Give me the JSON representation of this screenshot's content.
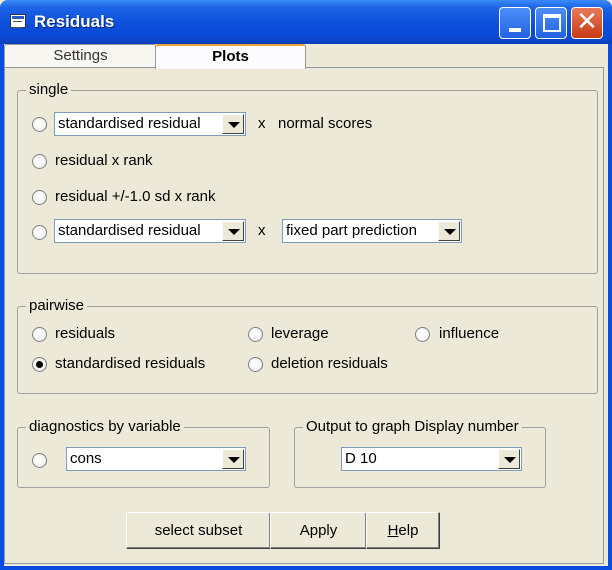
{
  "window": {
    "title": "Residuals",
    "controls": [
      "minimize-icon",
      "maximize-icon",
      "close-icon"
    ],
    "close_glyph": "✕"
  },
  "tabs": [
    {
      "label": "Settings",
      "active": false
    },
    {
      "label": "Plots",
      "active": true
    }
  ],
  "single": {
    "legend": "single",
    "rows": [
      {
        "combo1": "standardised residual",
        "x": "x",
        "text": "normal scores"
      },
      {
        "text": "residual x rank"
      },
      {
        "text": "residual +/-1.0 sd x  rank"
      },
      {
        "combo1": "standardised residual",
        "x": "x",
        "combo2": "fixed part prediction"
      }
    ]
  },
  "pairwise": {
    "legend": "pairwise",
    "options": [
      {
        "label": "residuals",
        "checked": false
      },
      {
        "label": "leverage",
        "checked": false
      },
      {
        "label": "influence",
        "checked": false
      },
      {
        "label": "standardised residuals",
        "checked": true
      },
      {
        "label": "deletion residuals",
        "checked": false
      }
    ]
  },
  "diagnostics": {
    "legend": "diagnostics by variable",
    "value": "cons"
  },
  "output": {
    "legend": "Output to graph Display number",
    "value": "D 10"
  },
  "buttons": {
    "select_subset": "select subset",
    "apply": "Apply",
    "help": "Help"
  }
}
